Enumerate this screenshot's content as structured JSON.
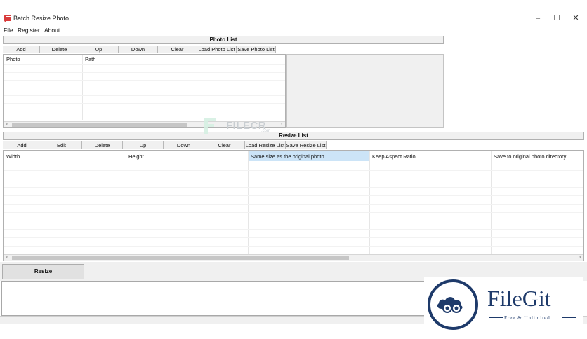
{
  "window": {
    "title": "Batch Resize Photo",
    "minimize": "–",
    "maximize": "☐",
    "close": "✕"
  },
  "menu": [
    "File",
    "Register",
    "About"
  ],
  "photo_section": {
    "header": "Photo List",
    "toolbar": [
      "Add",
      "Delete",
      "Up",
      "Down",
      "Clear",
      "Load Photo List",
      "Save Photo List"
    ],
    "columns": [
      "Photo",
      "Path"
    ]
  },
  "resize_section": {
    "header": "Resize List",
    "toolbar": [
      "Add",
      "Edit",
      "Delete",
      "Up",
      "Down",
      "Clear",
      "Load Resize List",
      "Save Resize List"
    ],
    "columns": [
      "Width",
      "Height",
      "Same size as the original photo",
      "Keep Aspect Ratio",
      "Save to original photo directory"
    ]
  },
  "resize_button": "Resize",
  "scroll": {
    "left_arrow": "‹",
    "right_arrow": "›"
  },
  "watermarks": {
    "filecr": {
      "name": "FILECR",
      "domain": ".com"
    },
    "filegit": {
      "name": "FileGit",
      "tagline": "Free & Unlimited"
    }
  },
  "colors": {
    "selected_header_bg": "#cce4f7",
    "app_icon": "#d83b3b",
    "filegit_brand": "#1e3a6a"
  }
}
